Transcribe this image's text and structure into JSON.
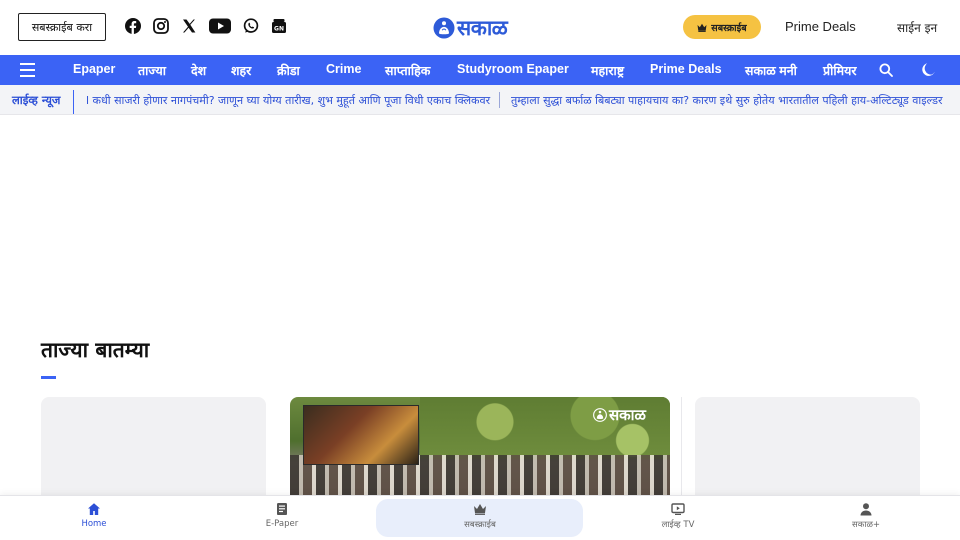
{
  "header": {
    "subscribe_button": "सबस्क्राईब करा",
    "socials": [
      "facebook-icon",
      "instagram-icon",
      "x-icon",
      "youtube-icon",
      "whatsapp-icon",
      "google-news-icon"
    ],
    "logo_text": "सकाळ",
    "subscribe_pill": "सबस्क्राईब",
    "prime_deals": "Prime Deals",
    "sign_in": "साईन इन"
  },
  "nav": {
    "items": [
      "Epaper",
      "ताज्या",
      "देश",
      "शहर",
      "क्रीडा",
      "Crime",
      "साप्ताहिक",
      "Studyroom Epaper",
      "महाराष्ट्र",
      "Prime Deals",
      "सकाळ मनी",
      "प्रीमियर"
    ]
  },
  "ticker": {
    "label": "लाईव्ह न्यूज",
    "items": [
      "l कधी साजरी होणार नागपंचमी? जाणून घ्या योग्य तारीख, शुभ मुहूर्त आणि पूजा विधी एकाच क्लिकवर",
      "तुम्हाला सुद्धा बर्फाळ बिबट्या पाहायचाय का? कारण इथे सुरु होतेय भारतातील पहिली हाय-अल्टिट्यूड वाइल्डर"
    ]
  },
  "section": {
    "title": "ताज्या बातम्या",
    "photo_watermark": "सकाळ"
  },
  "bottom_nav": {
    "items": [
      {
        "label": "Home",
        "icon": "home-icon",
        "active": true
      },
      {
        "label": "E-Paper",
        "icon": "epaper-icon",
        "active": false
      },
      {
        "label": "सबस्क्राईब",
        "icon": "crown-icon",
        "active": false
      },
      {
        "label": "लाईव्ह TV",
        "icon": "tv-icon",
        "active": false
      },
      {
        "label": "सकाळ+",
        "icon": "user-icon",
        "active": false
      }
    ]
  },
  "colors": {
    "brand_blue": "#3b63f5",
    "subscribe_gold": "#f5c242",
    "ticker_text": "#2c4fd6"
  }
}
